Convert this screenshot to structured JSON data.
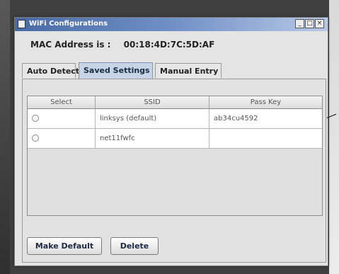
{
  "window": {
    "title": "WiFi Configurations",
    "controls": {
      "minimize": "_",
      "maximize": "□",
      "close": "×"
    }
  },
  "mac": {
    "label": "MAC Address is :",
    "value": "00:18:4D:7C:5D:AF"
  },
  "tabs": [
    {
      "label": "Auto Detect",
      "active": false
    },
    {
      "label": "Saved Settings",
      "active": true
    },
    {
      "label": "Manual Entry",
      "active": false
    }
  ],
  "table": {
    "columns": [
      "Select",
      "SSID",
      "Pass Key"
    ],
    "rows": [
      {
        "ssid": "linksys (default)",
        "pass_key": "ab34cu4592",
        "selected": false
      },
      {
        "ssid": "net11fwfc",
        "pass_key": "",
        "selected": false
      }
    ]
  },
  "buttons": {
    "make_default": "Make Default",
    "delete": "Delete"
  }
}
